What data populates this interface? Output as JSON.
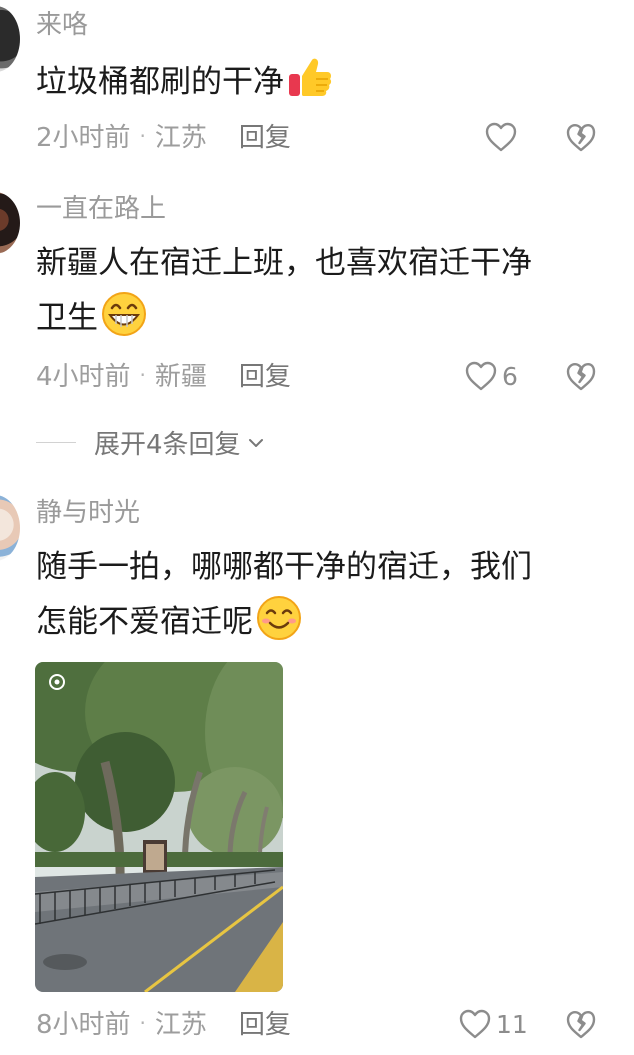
{
  "comments": [
    {
      "username": "来咯",
      "text": "垃圾桶都刷的干净",
      "emoji": "thumbs-up-emoji",
      "time": "2小时前",
      "location": "江苏",
      "reply": "回复",
      "likes": ""
    },
    {
      "username": "一直在路上",
      "text_line1": "新疆人在宿迁上班，也喜欢宿迁干净",
      "text_line2": "卫生",
      "emoji": "grinning-face-emoji",
      "time": "4小时前",
      "location": "新疆",
      "reply": "回复",
      "likes": "6",
      "expand_label": "展开4条回复"
    },
    {
      "username": "静与时光",
      "text_line1": "随手一拍，哪哪都干净的宿迁，我们",
      "text_line2": "怎能不爱宿迁呢",
      "emoji": "smiling-face-emoji",
      "image": "street-photo",
      "time": "8小时前",
      "location": "江苏",
      "reply": "回复",
      "likes": "11"
    }
  ],
  "colors": {
    "text": "#1b1b1b",
    "meta": "#9d9d9d",
    "icon": "#8c8c8c"
  }
}
